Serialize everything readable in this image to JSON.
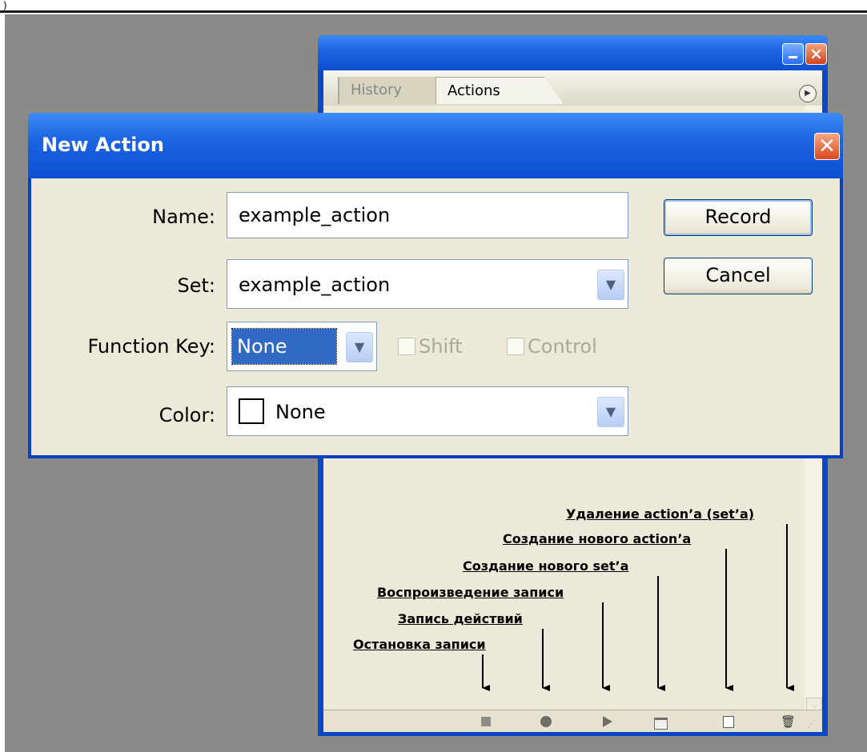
{
  "page_mark": ")",
  "palette": {
    "tabs": [
      "History",
      "Actions"
    ],
    "active_tab": "Actions",
    "toolbar_icons": [
      "stop-icon",
      "record-icon",
      "play-icon",
      "new-set-icon",
      "new-action-icon",
      "trash-icon"
    ]
  },
  "annotations": {
    "delete": "Удаление action’a (set’a)",
    "new_action": "Создание нового action’a",
    "new_set": "Создание нового set’a",
    "play": "Воспроизведение записи",
    "record": "Запись действий",
    "stop": "Остановка записи"
  },
  "dialog": {
    "title": "New Action",
    "name_label": "Name:",
    "name_value": "example_action",
    "set_label": "Set:",
    "set_value": "example_action",
    "fkey_label": "Function Key:",
    "fkey_value": "None",
    "shift_label": "Shift",
    "control_label": "Control",
    "color_label": "Color:",
    "color_value": "None",
    "record_label": "Record",
    "cancel_label": "Cancel"
  },
  "colors": {
    "titlebar": "#0b4fd1",
    "dialog_bg": "#ece9d8",
    "selection": "#316ac5",
    "close_button": "#d9471d"
  }
}
